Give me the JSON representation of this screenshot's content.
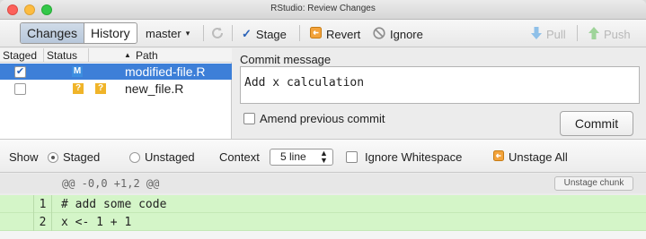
{
  "window": {
    "title": "RStudio: Review Changes"
  },
  "toolbar": {
    "tabs": [
      "Changes",
      "History"
    ],
    "branch": "master",
    "stage_label": "Stage",
    "revert_label": "Revert",
    "ignore_label": "Ignore",
    "pull_label": "Pull",
    "push_label": "Push"
  },
  "files": {
    "headers": {
      "staged": "Staged",
      "status": "Status",
      "path": "Path"
    },
    "rows": [
      {
        "staged": true,
        "status": [
          "M"
        ],
        "path": "modified-file.R",
        "selected": true
      },
      {
        "staged": false,
        "status": [
          "?",
          "?"
        ],
        "path": "new_file.R",
        "selected": false
      }
    ]
  },
  "commit": {
    "label": "Commit message",
    "message": "Add x calculation",
    "amend_label": "Amend previous commit",
    "button_label": "Commit"
  },
  "showbar": {
    "show_label": "Show",
    "staged_label": "Staged",
    "unstaged_label": "Unstaged",
    "selected": "Staged",
    "context_label": "Context",
    "context_value": "5 line",
    "ignore_ws_label": "Ignore Whitespace",
    "unstage_all_label": "Unstage All"
  },
  "diff": {
    "hunk_header": "@@ -0,0 +1,2 @@",
    "unstage_chunk_label": "Unstage chunk",
    "lines": [
      {
        "new_no": "1",
        "code": "# add some code"
      },
      {
        "new_no": "2",
        "code": "x <- 1 + 1"
      }
    ]
  },
  "colors": {
    "selection": "#3d7fd8",
    "added_line": "#d4f5c8",
    "modified_badge": "#3d8ee0",
    "untracked_badge": "#f0b429"
  }
}
